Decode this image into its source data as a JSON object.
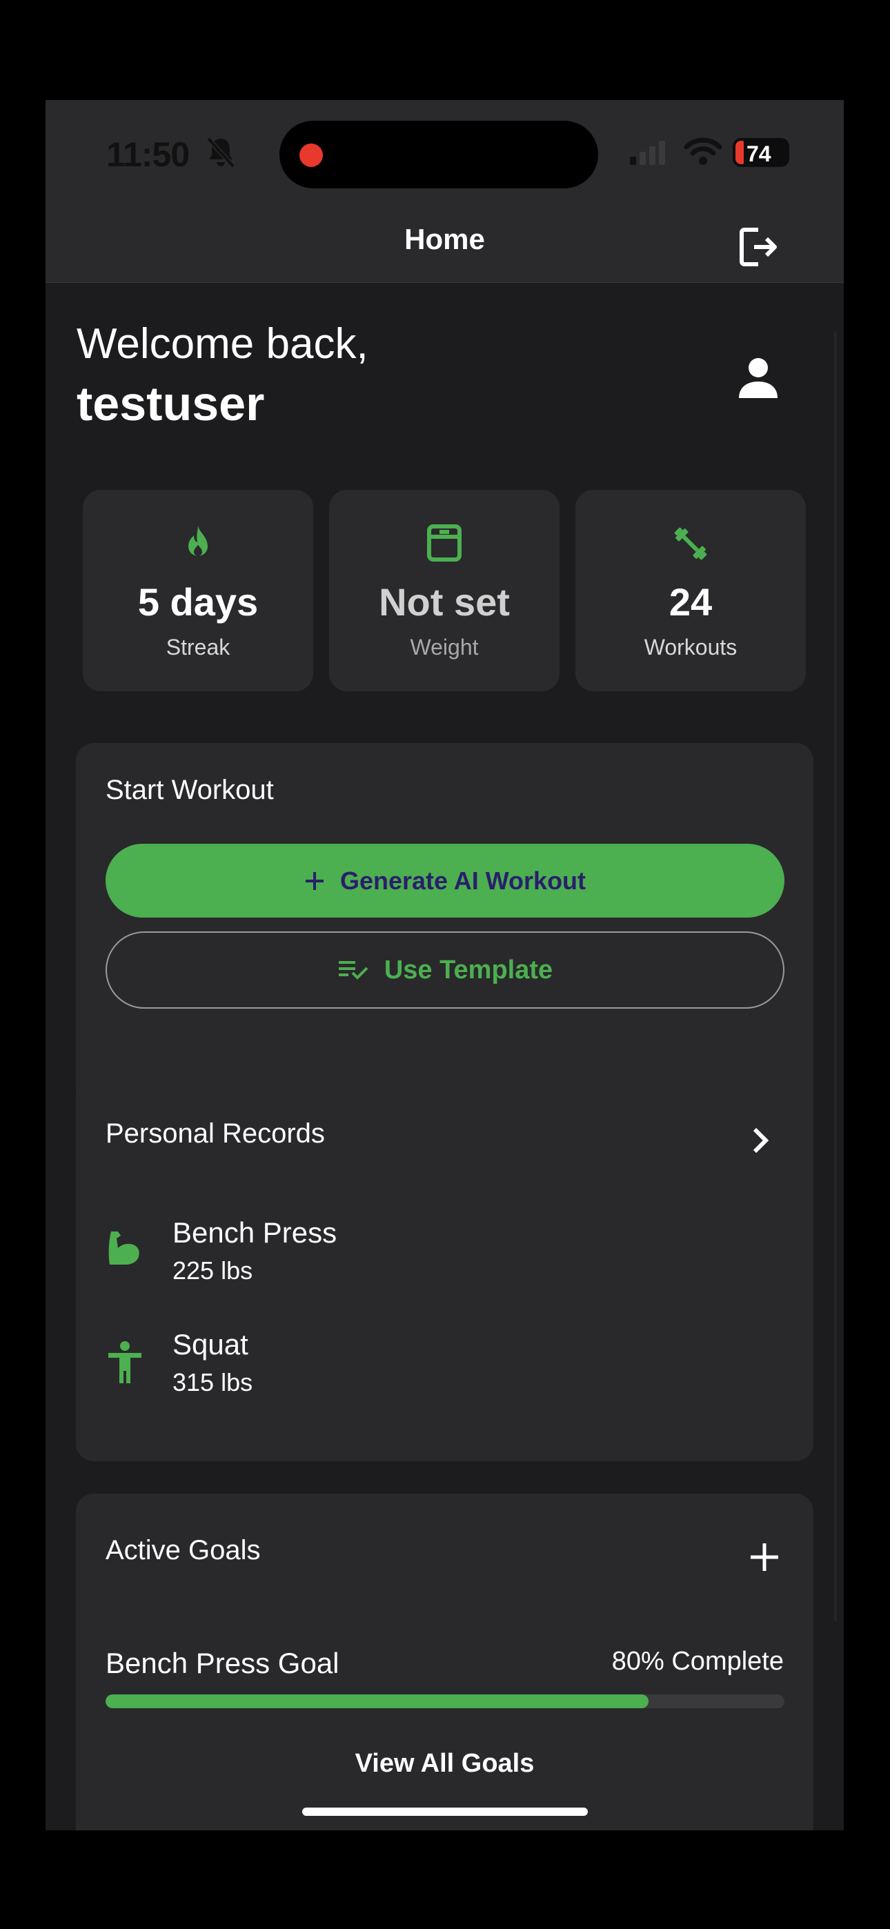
{
  "status_bar": {
    "time": "11:50",
    "battery": "74",
    "icons": [
      "bell-slash-icon",
      "signal-icon",
      "wifi-icon",
      "battery-icon"
    ]
  },
  "header": {
    "title": "Home",
    "logout_icon": "logout-icon"
  },
  "welcome": {
    "greeting": "Welcome back,",
    "username": "testuser",
    "profile_icon": "person-icon"
  },
  "stats": [
    {
      "icon": "flame-icon",
      "value": "5 days",
      "label": "Streak"
    },
    {
      "icon": "scale-icon",
      "value": "Not set",
      "label": "Weight"
    },
    {
      "icon": "dumbbell-icon",
      "value": "24",
      "label": "Workouts"
    }
  ],
  "start_workout": {
    "title": "Start Workout",
    "generate_label": "Generate AI Workout",
    "template_label": "Use Template"
  },
  "personal_records": {
    "title": "Personal Records",
    "items": [
      {
        "icon": "flexed-arm-icon",
        "name": "Bench Press",
        "value": "225 lbs"
      },
      {
        "icon": "person-standing-icon",
        "name": "Squat",
        "value": "315 lbs"
      }
    ]
  },
  "active_goals": {
    "title": "Active Goals",
    "goal_name": "Bench Press Goal",
    "goal_progress_label": "80% Complete",
    "goal_progress": 0.8,
    "view_all_label": "View All Goals"
  },
  "colors": {
    "accent": "#4caf50",
    "background": "#1c1c1e",
    "card": "#29292b",
    "generate_text": "#2a1f6b",
    "record_dot": "#e8392c"
  }
}
